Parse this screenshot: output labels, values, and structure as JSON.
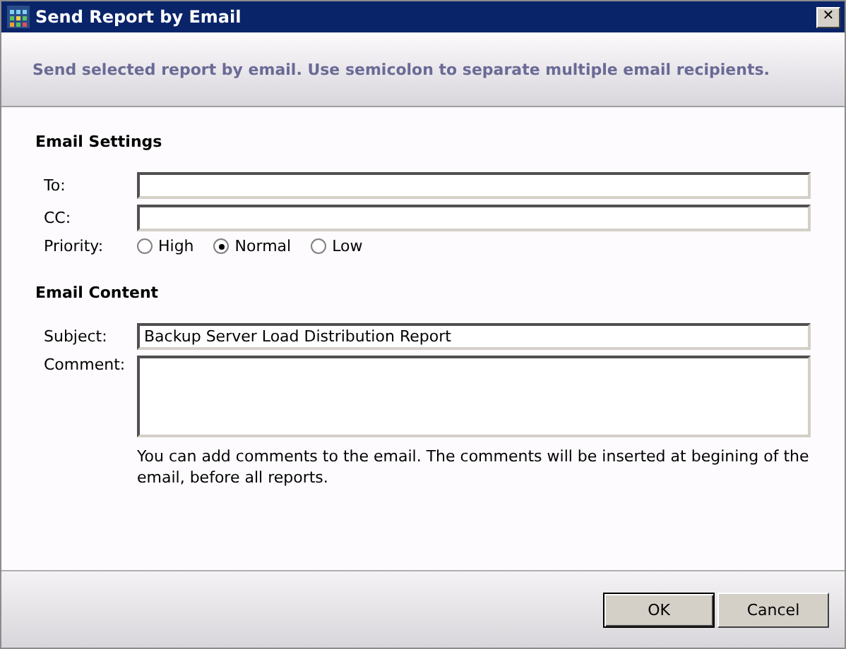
{
  "window": {
    "title": "Send Report by Email",
    "close": "✕"
  },
  "header": {
    "text": "Send selected report by email. Use semicolon to separate multiple email recipients."
  },
  "email_settings": {
    "title": "Email Settings",
    "to": {
      "label": "To:"
    },
    "cc": {
      "label": "CC:"
    },
    "priority": {
      "label": "Priority:",
      "options": [
        {
          "label": "High",
          "selected": false
        },
        {
          "label": "Normal",
          "selected": true
        },
        {
          "label": "Low",
          "selected": false
        }
      ]
    }
  },
  "email_content": {
    "title": "Email Content",
    "subject": {
      "label": "Subject:",
      "value": "Backup Server Load Distribution Report"
    },
    "comment": {
      "label": "Comment:",
      "hint": "You can add comments to the email. The comments will be inserted at begining of the email, before all reports."
    }
  },
  "buttons": [
    {
      "label": "OK",
      "default": true
    },
    {
      "label": "Cancel",
      "default": false
    }
  ]
}
